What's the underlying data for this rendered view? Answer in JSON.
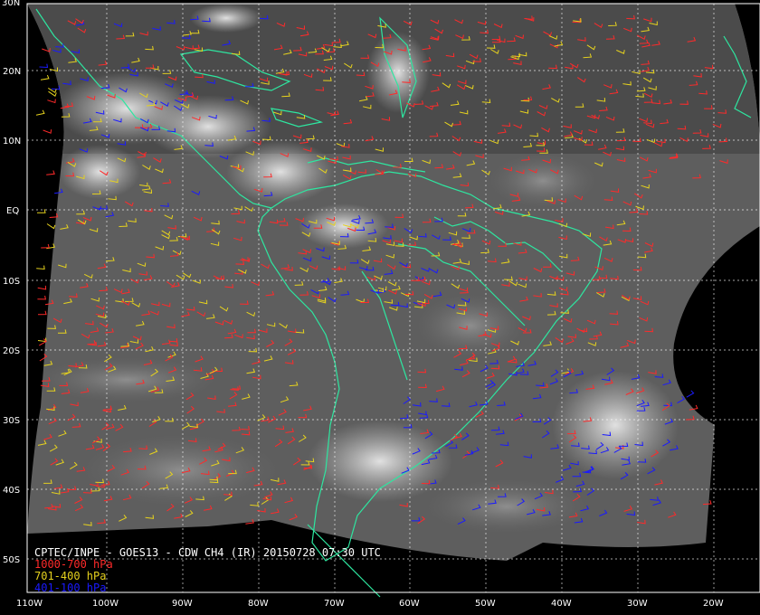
{
  "title": "CPTEC/INPE - GOES13 - CDW CH4 (IR) 20150728 07:30 UTC",
  "lat_labels": [
    "30N",
    "20N",
    "10N",
    "EQ",
    "10S",
    "20S",
    "30S",
    "40S",
    "50S"
  ],
  "lon_labels": [
    "110W",
    "100W",
    "90W",
    "80W",
    "70W",
    "60W",
    "50W",
    "40W",
    "30W",
    "20W"
  ],
  "legend": [
    {
      "label": "1000-700 hPa",
      "color": "#ff2a2a"
    },
    {
      "label": "701-400 hPa",
      "color": "#e6d21e"
    },
    {
      "label": "401-100 hPa",
      "color": "#1a1aff"
    }
  ],
  "colors": {
    "coastline": "#2ee6a0",
    "grid": "#ffffff",
    "background": "#000000"
  }
}
